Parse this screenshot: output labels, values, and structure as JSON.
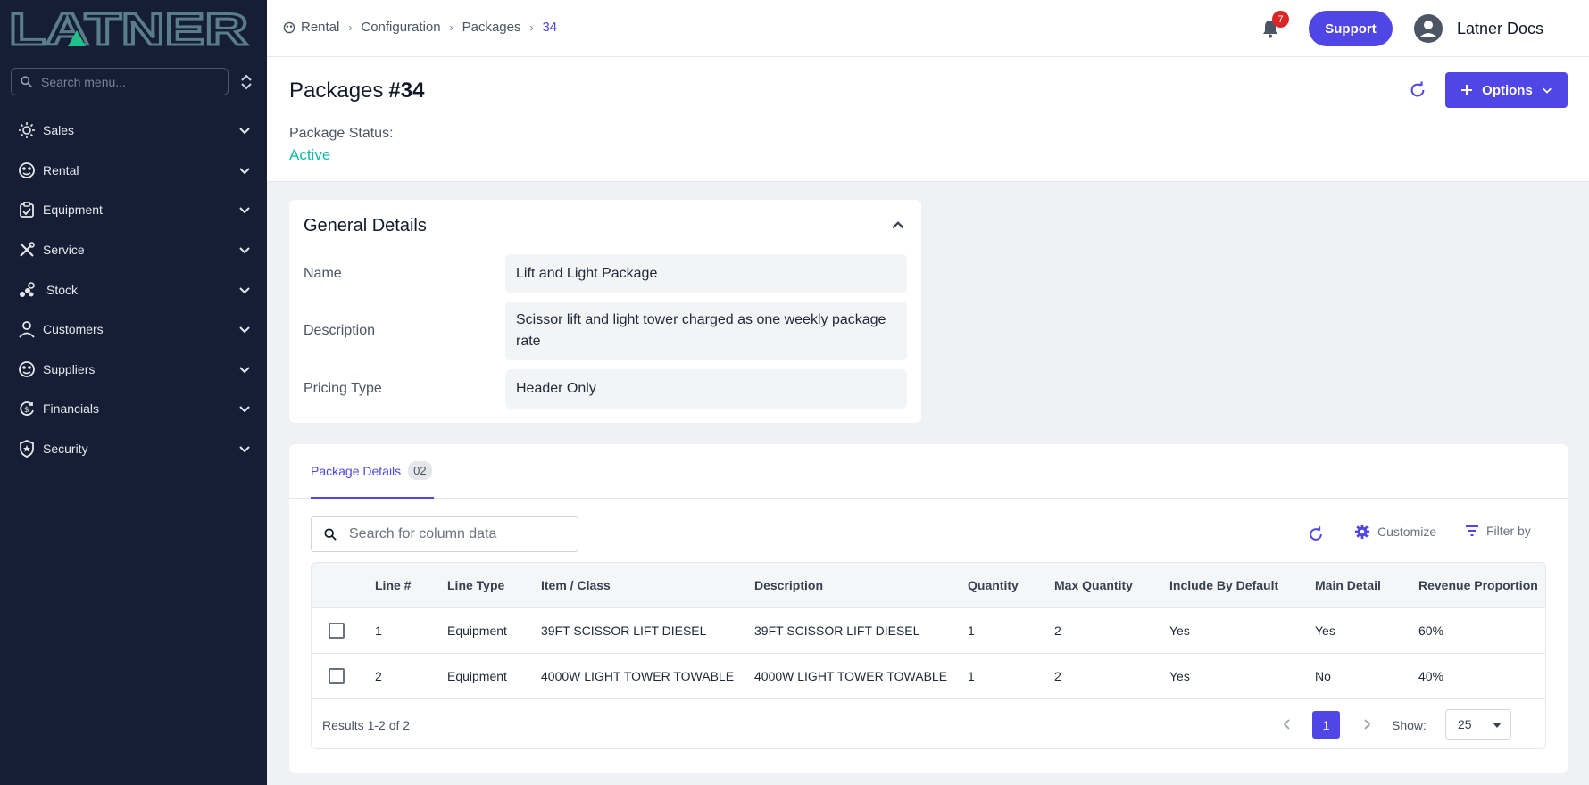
{
  "brand": {
    "logo_text": "LATNER"
  },
  "sidebar": {
    "search_placeholder": "Search menu...",
    "items": [
      {
        "label": "Sales",
        "icon": "sales-icon"
      },
      {
        "label": "Rental",
        "icon": "rental-icon"
      },
      {
        "label": "Equipment",
        "icon": "equipment-icon"
      },
      {
        "label": "Service",
        "icon": "service-icon"
      },
      {
        "label": "Stock",
        "icon": "stock-icon"
      },
      {
        "label": "Customers",
        "icon": "customers-icon"
      },
      {
        "label": "Suppliers",
        "icon": "suppliers-icon"
      },
      {
        "label": "Financials",
        "icon": "financials-icon"
      },
      {
        "label": "Security",
        "icon": "security-icon"
      }
    ]
  },
  "topbar": {
    "breadcrumbs": [
      "Rental",
      "Configuration",
      "Packages",
      "34"
    ],
    "notification_count": "7",
    "support_label": "Support",
    "user_name": "Latner Docs"
  },
  "header": {
    "title": "Packages",
    "record_id": "#34",
    "status_label": "Package Status:",
    "status_value": "Active",
    "options_label": "Options"
  },
  "general": {
    "title": "General Details",
    "fields": [
      {
        "label": "Name",
        "value": "Lift and Light Package"
      },
      {
        "label": "Description",
        "value": "Scissor lift and light tower charged as one weekly package rate"
      },
      {
        "label": "Pricing Type",
        "value": "Header Only"
      }
    ]
  },
  "package_details": {
    "tab_label": "Package Details",
    "tab_count": "02",
    "search_placeholder": "Search for column data",
    "customize_label": "Customize",
    "filter_label": "Filter by",
    "columns": [
      "Line #",
      "Line Type",
      "Item / Class",
      "Description",
      "Quantity",
      "Max Quantity",
      "Include By Default",
      "Main Detail",
      "Revenue Proportion"
    ],
    "rows": [
      [
        "1",
        "Equipment",
        "39FT SCISSOR LIFT DIESEL",
        "39FT SCISSOR LIFT DIESEL",
        "1",
        "2",
        "Yes",
        "Yes",
        "60%"
      ],
      [
        "2",
        "Equipment",
        "4000W LIGHT TOWER TOWABLE",
        "4000W LIGHT TOWER TOWABLE",
        "1",
        "2",
        "Yes",
        "No",
        "40%"
      ]
    ],
    "results_text": "Results 1-2 of 2",
    "current_page": "1",
    "show_label": "Show:",
    "page_size": "25"
  },
  "colors": {
    "accent": "#4f46e5",
    "sidebar_bg": "#161e36",
    "status_active": "#14b8a6",
    "badge": "#dc2626"
  }
}
